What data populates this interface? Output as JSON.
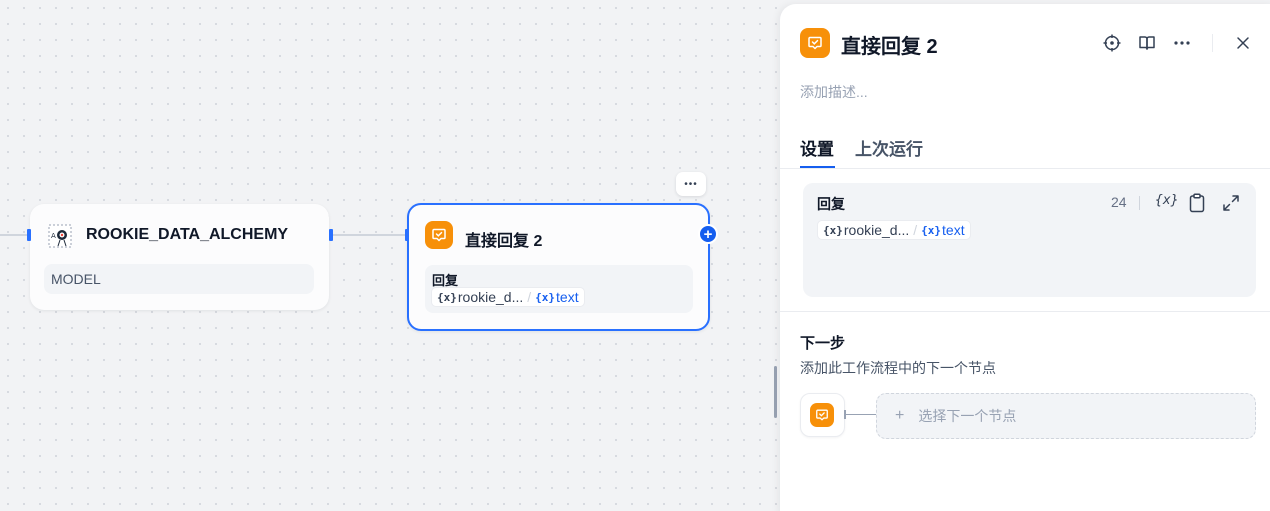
{
  "canvas": {
    "model_node": {
      "title": "ROOKIE_DATA_ALCHEMY",
      "model_label": "MODEL",
      "icon": "model-logo-icon"
    },
    "answer_node": {
      "title": "直接回复 2",
      "section_label": "回复",
      "var_node": "rookie_d...",
      "var_field": "text",
      "more_label": "•••",
      "icon": "message-check-icon"
    }
  },
  "panel": {
    "title": "直接回复 2",
    "description_placeholder": "添加描述...",
    "tabs": [
      "设置",
      "上次运行"
    ],
    "active_tab": "设置",
    "reply": {
      "label": "回复",
      "char_count": "24",
      "var_node": "rookie_d...",
      "var_field": "text"
    },
    "next_step": {
      "title": "下一步",
      "subtitle": "添加此工作流程中的下一个节点",
      "select_label": "选择下一个节点",
      "plus": "+"
    },
    "header_icons": [
      "locate-icon",
      "book-icon",
      "more-icon",
      "close-icon"
    ]
  },
  "colors": {
    "accent": "#155eef",
    "node_orange": "#f79009",
    "handle_blue": "#2970ff"
  }
}
